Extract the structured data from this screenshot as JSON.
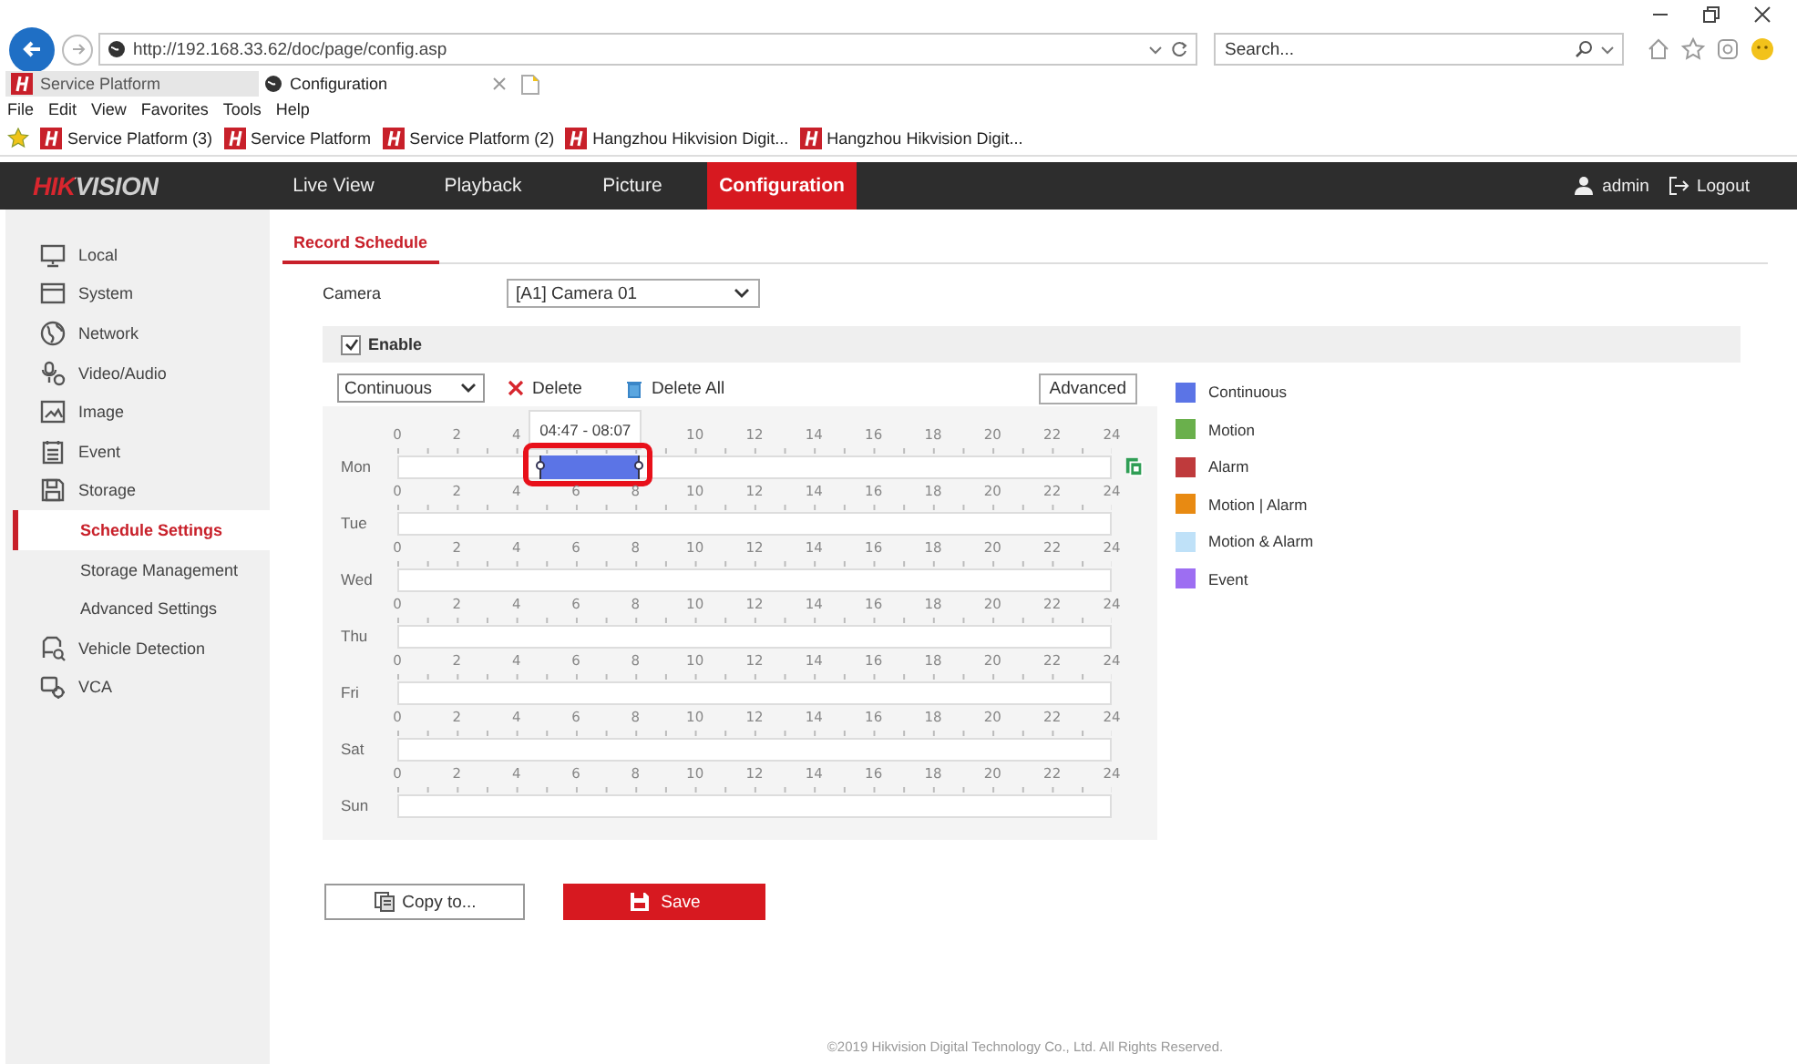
{
  "browser": {
    "address": "http://192.168.33.62/doc/page/config.asp",
    "search": {
      "placeholder": "Search..."
    },
    "tabs": [
      {
        "label": "Service Platform",
        "selected": false
      },
      {
        "label": "Configuration",
        "selected": true
      }
    ],
    "menu": [
      "File",
      "Edit",
      "View",
      "Favorites",
      "Tools",
      "Help"
    ],
    "favorites": [
      "Service Platform (3)",
      "Service Platform",
      "Service Platform (2)",
      "Hangzhou Hikvision Digit...",
      "Hangzhou Hikvision Digit..."
    ]
  },
  "app": {
    "logo": "HIKVISION",
    "nav": [
      {
        "label": "Live View",
        "selected": false
      },
      {
        "label": "Playback",
        "selected": false
      },
      {
        "label": "Picture",
        "selected": false
      },
      {
        "label": "Configuration",
        "selected": true
      }
    ],
    "user": "admin",
    "logout": "Logout"
  },
  "sidebar": {
    "items": [
      {
        "label": "Local",
        "kind": "monitor",
        "selected": false
      },
      {
        "label": "System",
        "kind": "window",
        "selected": false
      },
      {
        "label": "Network",
        "kind": "globe",
        "selected": false
      },
      {
        "label": "Video/Audio",
        "kind": "media",
        "selected": false
      },
      {
        "label": "Image",
        "kind": "image",
        "selected": false
      },
      {
        "label": "Event",
        "kind": "list",
        "selected": false
      },
      {
        "label": "Storage",
        "kind": "disk",
        "selected": false,
        "children": [
          {
            "label": "Schedule Settings",
            "selected": true
          },
          {
            "label": "Storage Management",
            "selected": false
          },
          {
            "label": "Advanced Settings",
            "selected": false
          }
        ]
      },
      {
        "label": "Vehicle Detection",
        "kind": "vehicle",
        "selected": false
      },
      {
        "label": "VCA",
        "kind": "vca",
        "selected": false
      }
    ]
  },
  "page": {
    "tabs": [
      {
        "label": "Record Schedule",
        "selected": true
      }
    ],
    "camera": {
      "label": "Camera",
      "value": "[A1] Camera 01"
    },
    "enable": {
      "label": "Enable",
      "checked": true
    },
    "mode": {
      "value": "Continuous"
    },
    "delete": "Delete",
    "delete_all": "Delete All",
    "advanced": "Advanced",
    "schedule": {
      "days": [
        {
          "label": "Mon",
          "active": true,
          "ticks": [
            "0",
            "2",
            "4",
            "10",
            "12",
            "14",
            "16",
            "18",
            "20",
            "22",
            "24"
          ],
          "segments": [
            {
              "tooltip": "04:47 - 08:07",
              "color": "#5b74e6",
              "highlighted": true
            }
          ]
        },
        {
          "label": "Tue",
          "active": false,
          "ticks": [
            "0",
            "2",
            "4",
            "6",
            "8",
            "10",
            "12",
            "14",
            "16",
            "18",
            "20",
            "22",
            "24"
          ]
        },
        {
          "label": "Wed",
          "active": false,
          "ticks": [
            "0",
            "2",
            "4",
            "6",
            "8",
            "10",
            "12",
            "14",
            "16",
            "18",
            "20",
            "22",
            "24"
          ]
        },
        {
          "label": "Thu",
          "active": false,
          "ticks": [
            "0",
            "2",
            "4",
            "6",
            "8",
            "10",
            "12",
            "14",
            "16",
            "18",
            "20",
            "22",
            "24"
          ]
        },
        {
          "label": "Fri",
          "active": false,
          "ticks": [
            "0",
            "2",
            "4",
            "6",
            "8",
            "10",
            "12",
            "14",
            "16",
            "18",
            "20",
            "22",
            "24"
          ]
        },
        {
          "label": "Sat",
          "active": false,
          "ticks": [
            "0",
            "2",
            "4",
            "6",
            "8",
            "10",
            "12",
            "14",
            "16",
            "18",
            "20",
            "22",
            "24"
          ]
        },
        {
          "label": "Sun",
          "active": false,
          "ticks": [
            "0",
            "2",
            "4",
            "6",
            "8",
            "10",
            "12",
            "14",
            "16",
            "18",
            "20",
            "22",
            "24"
          ]
        }
      ]
    },
    "legend": [
      {
        "label": "Continuous",
        "color": "#5b74e6"
      },
      {
        "label": "Motion",
        "color": "#6ab04c"
      },
      {
        "label": "Alarm",
        "color": "#bf3a3c"
      },
      {
        "label": "Motion | Alarm",
        "color": "#e88a12"
      },
      {
        "label": "Motion & Alarm",
        "color": "#bfe1f8"
      },
      {
        "label": "Event",
        "color": "#9d6ef2"
      }
    ],
    "copy_to": "Copy to...",
    "save": "Save"
  },
  "footer": "©2019 Hikvision Digital Technology Co., Ltd. All Rights Reserved."
}
